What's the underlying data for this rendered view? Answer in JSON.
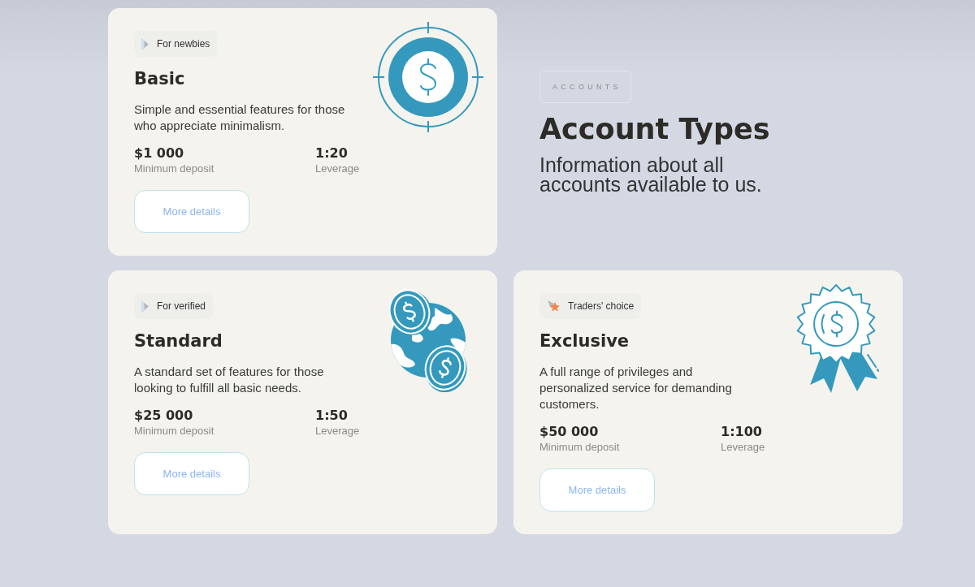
{
  "heading": {
    "eyebrow": "ACCOUNTS",
    "title": "Account Types",
    "subtitle": "Information about all accounts available to us."
  },
  "accounts": [
    {
      "kind": "target",
      "tag": {
        "kind": "pointer",
        "label": "For newbies"
      },
      "name": "Basic",
      "description": "Simple and essential features for those who appreciate minimalism.",
      "stats": [
        {
          "value": "$1 000",
          "label": "Minimum deposit"
        },
        {
          "value": "1:20",
          "label": "Leverage"
        }
      ],
      "button": "More details"
    },
    {
      "kind": "globe",
      "tag": {
        "kind": "pointer",
        "label": "For verified"
      },
      "name": "Standard",
      "description": "A standard set of features for those looking to fulfill all basic needs.",
      "stats": [
        {
          "value": "$25 000",
          "label": "Minimum deposit"
        },
        {
          "value": "1:50",
          "label": "Leverage"
        }
      ],
      "button": "More details"
    },
    {
      "kind": "rosette",
      "tag": {
        "kind": "star",
        "label": "Traders' choice"
      },
      "name": "Exclusive",
      "description": "A full range of privileges and personalized service for demanding customers.",
      "stats": [
        {
          "value": "$50 000",
          "label": "Minimum deposit"
        },
        {
          "value": "1:100",
          "label": "Leverage"
        }
      ],
      "button": "More details"
    }
  ]
}
